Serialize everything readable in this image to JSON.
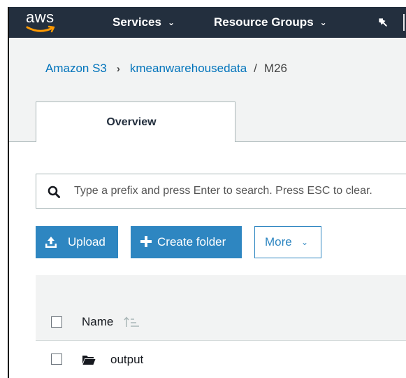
{
  "topnav": {
    "logo_text": "aws",
    "services_label": "Services",
    "resource_groups_label": "Resource Groups",
    "icons": {
      "dropdown": "chevron-down-icon",
      "pin": "pin-icon"
    }
  },
  "breadcrumb": {
    "root": "Amazon S3",
    "separator": "›",
    "bucket": "kmeanwarehousedata",
    "slash": "/",
    "folder": "M26"
  },
  "tabs": [
    {
      "label": "Overview",
      "active": true
    }
  ],
  "search": {
    "placeholder": "Type a prefix and press Enter to search. Press ESC to clear."
  },
  "toolbar": {
    "upload_label": "Upload",
    "create_folder_label": "Create folder",
    "more_label": "More"
  },
  "table": {
    "columns": [
      {
        "label": "Name",
        "sort_icon": "sort-ascending-icon"
      }
    ],
    "rows": [
      {
        "name": "output",
        "type": "folder",
        "icon": "folder-icon"
      }
    ]
  },
  "colors": {
    "nav_bg": "#232f3e",
    "accent": "#2e86c1",
    "link": "#0073bb",
    "panel_bg": "#f2f3f3"
  }
}
